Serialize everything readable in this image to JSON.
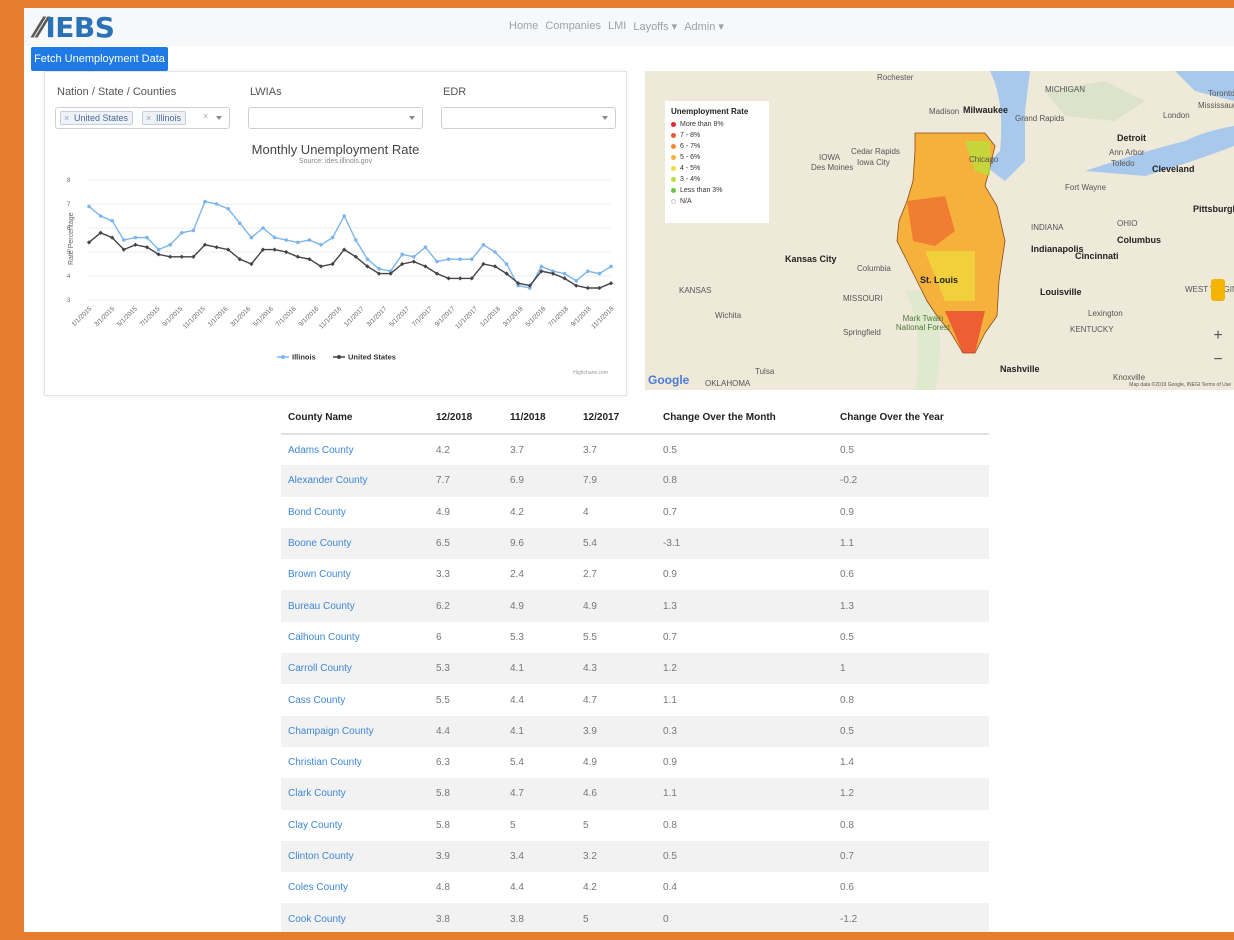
{
  "app": {
    "logo": "IEBS"
  },
  "nav": {
    "items": [
      "Home",
      "Companies",
      "LMI",
      "Layoffs ▾",
      "Admin ▾"
    ]
  },
  "toolbar": {
    "fetch_label": "Fetch Unemployment Data"
  },
  "filters": {
    "nation_label": "Nation / State / Counties",
    "nation_tags": [
      "United States",
      "Illinois"
    ],
    "lwia_label": "LWIAs",
    "edr_label": "EDR"
  },
  "chart_data": {
    "type": "line",
    "title": "Monthly Unemployment Rate",
    "subtitle": "Source: ides.illinois.gov",
    "ylabel": "Rate Percentage",
    "ylim": [
      3,
      8
    ],
    "yticks": [
      3,
      4,
      5,
      6,
      7,
      8
    ],
    "x_ticks": [
      "1/1/2015",
      "3/1/2015",
      "5/1/2015",
      "7/1/2015",
      "9/1/2015",
      "11/1/2015",
      "1/1/2016",
      "3/1/2016",
      "5/1/2016",
      "7/1/2016",
      "9/1/2016",
      "11/1/2016",
      "1/1/2017",
      "3/1/2017",
      "5/1/2017",
      "7/1/2017",
      "9/1/2017",
      "11/1/2017",
      "1/1/2018",
      "3/1/2018",
      "5/1/2018",
      "7/1/2018",
      "9/1/2018",
      "11/1/2018"
    ],
    "series": [
      {
        "name": "Illinois",
        "color": "#7cb5ec",
        "values": [
          6.9,
          6.5,
          6.3,
          5.5,
          5.6,
          5.6,
          5.1,
          5.3,
          5.8,
          5.9,
          7.1,
          7.0,
          6.8,
          6.2,
          5.6,
          6.0,
          5.6,
          5.5,
          5.4,
          5.5,
          5.3,
          5.6,
          6.5,
          5.5,
          4.7,
          4.3,
          4.2,
          4.9,
          4.8,
          5.2,
          4.6,
          4.7,
          4.7,
          4.7,
          5.3,
          5.0,
          4.5,
          3.6,
          3.5,
          4.4,
          4.2,
          4.1,
          3.8,
          4.2,
          4.1,
          4.4
        ]
      },
      {
        "name": "United States",
        "color": "#434348",
        "values": [
          5.4,
          5.8,
          5.6,
          5.1,
          5.3,
          5.2,
          4.9,
          4.8,
          4.8,
          4.8,
          5.3,
          5.2,
          5.1,
          4.7,
          4.5,
          5.1,
          5.1,
          5.0,
          4.8,
          4.7,
          4.4,
          4.5,
          5.1,
          4.8,
          4.4,
          4.1,
          4.1,
          4.5,
          4.6,
          4.4,
          4.1,
          3.9,
          3.9,
          3.9,
          4.5,
          4.4,
          4.1,
          3.7,
          3.6,
          4.2,
          4.1,
          3.9,
          3.6,
          3.5,
          3.5,
          3.7
        ]
      }
    ],
    "credit": "Highcharts.com",
    "legend": "bottom-center"
  },
  "map": {
    "legend_title": "Unemployment Rate",
    "legend_items": [
      {
        "label": "More than 8%",
        "color": "#e8262b"
      },
      {
        "label": "7 - 8%",
        "color": "#ee5a2b"
      },
      {
        "label": "6 - 7%",
        "color": "#f38a32"
      },
      {
        "label": "5 - 6%",
        "color": "#f6b13c"
      },
      {
        "label": "4 - 5%",
        "color": "#f0dd3c"
      },
      {
        "label": "3 - 4%",
        "color": "#b9df3a"
      },
      {
        "label": "Less than 3%",
        "color": "#6cc644"
      },
      {
        "label": "N/A",
        "color": "#ffffff"
      }
    ],
    "places": [
      "Rochester",
      "MICHIGAN",
      "Madison",
      "Milwaukee",
      "Grand Rapids",
      "Detroit",
      "London",
      "Toronto",
      "Mississauga",
      "Ann Arbor",
      "Toledo",
      "Cleveland",
      "IOWA",
      "Des Moines",
      "Cedar Rapids",
      "Iowa City",
      "Chicago",
      "Fort Wayne",
      "INDIANA",
      "OHIO",
      "Pittsburgh",
      "Indianapolis",
      "Columbus",
      "Cincinnati",
      "Kansas City",
      "Columbia",
      "St. Louis",
      "MISSOURI",
      "KANSAS",
      "Louisville",
      "Lexington",
      "WEST VIRGINIA",
      "KENTUCKY",
      "Wichita",
      "Springfield",
      "Mark Twain National Forest",
      "Nashville",
      "Tulsa",
      "OKLAHOMA",
      "Knoxville"
    ],
    "attribution": "Map data ©2019 Google, INEGI  Terms of Use",
    "google": "Google"
  },
  "table": {
    "headers": [
      "County Name",
      "12/2018",
      "11/2018",
      "12/2017",
      "Change Over the Month",
      "Change Over the Year"
    ],
    "rows": [
      [
        "Adams County",
        "4.2",
        "3.7",
        "3.7",
        "0.5",
        "0.5"
      ],
      [
        "Alexander County",
        "7.7",
        "6.9",
        "7.9",
        "0.8",
        "-0.2"
      ],
      [
        "Bond County",
        "4.9",
        "4.2",
        "4",
        "0.7",
        "0.9"
      ],
      [
        "Boone County",
        "6.5",
        "9.6",
        "5.4",
        "-3.1",
        "1.1"
      ],
      [
        "Brown County",
        "3.3",
        "2.4",
        "2.7",
        "0.9",
        "0.6"
      ],
      [
        "Bureau County",
        "6.2",
        "4.9",
        "4.9",
        "1.3",
        "1.3"
      ],
      [
        "Calhoun County",
        "6",
        "5.3",
        "5.5",
        "0.7",
        "0.5"
      ],
      [
        "Carroll County",
        "5.3",
        "4.1",
        "4.3",
        "1.2",
        "1"
      ],
      [
        "Cass County",
        "5.5",
        "4.4",
        "4.7",
        "1.1",
        "0.8"
      ],
      [
        "Champaign County",
        "4.4",
        "4.1",
        "3.9",
        "0.3",
        "0.5"
      ],
      [
        "Christian County",
        "6.3",
        "5.4",
        "4.9",
        "0.9",
        "1.4"
      ],
      [
        "Clark County",
        "5.8",
        "4.7",
        "4.6",
        "1.1",
        "1.2"
      ],
      [
        "Clay County",
        "5.8",
        "5",
        "5",
        "0.8",
        "0.8"
      ],
      [
        "Clinton County",
        "3.9",
        "3.4",
        "3.2",
        "0.5",
        "0.7"
      ],
      [
        "Coles County",
        "4.8",
        "4.4",
        "4.2",
        "0.4",
        "0.6"
      ],
      [
        "Cook County",
        "3.8",
        "3.8",
        "5",
        "0",
        "-1.2"
      ]
    ]
  }
}
